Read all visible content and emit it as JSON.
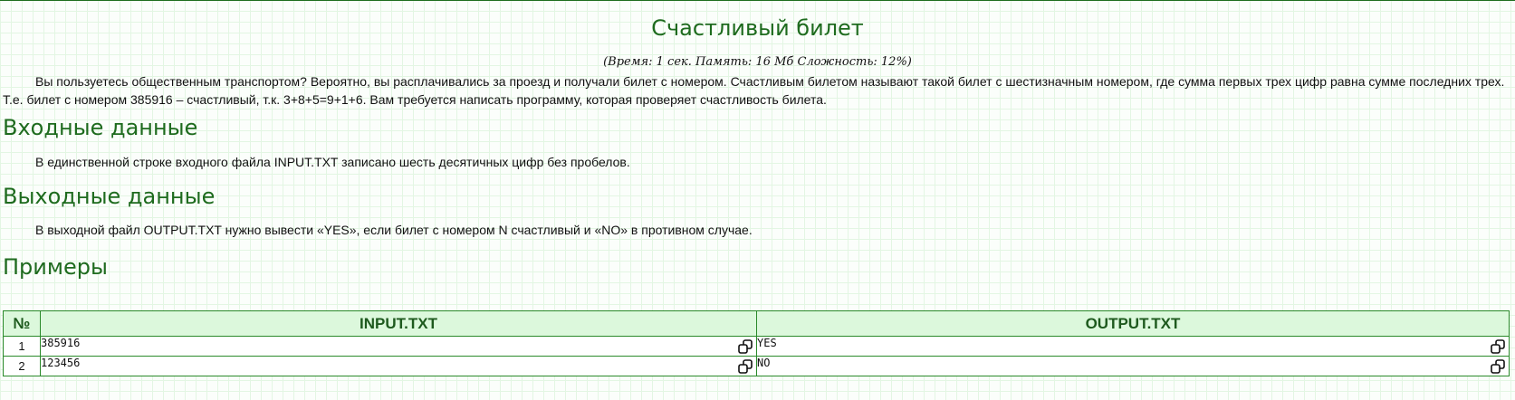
{
  "title": "Счастливый билет",
  "limits": "(Время: 1 сек. Память: 16 Мб Сложность: 12%)",
  "statement": "Вы пользуетесь общественным транспортом? Вероятно, вы расплачивались за проезд и получали билет с номером. Счастливым билетом называют такой билет с шестизначным номером, где сумма первых трех цифр равна сумме последних трех. Т.е. билет с номером 385916 – счастливый, т.к. 3+8+5=9+1+6. Вам требуется написать программу, которая проверяет счастливость билета.",
  "input": {
    "heading": "Входные данные",
    "text": "В единственной строке входного файла INPUT.TXT записано шесть десятичных цифр без пробелов."
  },
  "output": {
    "heading": "Выходные данные",
    "text": "В выходной файл OUTPUT.TXT нужно вывести «YES», если билет с номером N счастливый и «NO» в противном случае."
  },
  "examples": {
    "heading": "Примеры",
    "columns": [
      "№",
      "INPUT.TXT",
      "OUTPUT.TXT"
    ],
    "rows": [
      {
        "n": "1",
        "input": "385916",
        "output": "YES"
      },
      {
        "n": "2",
        "input": "123456",
        "output": "NO"
      }
    ],
    "copy_icon": "copy-icon"
  },
  "colors": {
    "heading": "#1e6b1e",
    "table_border": "#2a8a2a",
    "table_header_bg": "#dcf8dc"
  }
}
